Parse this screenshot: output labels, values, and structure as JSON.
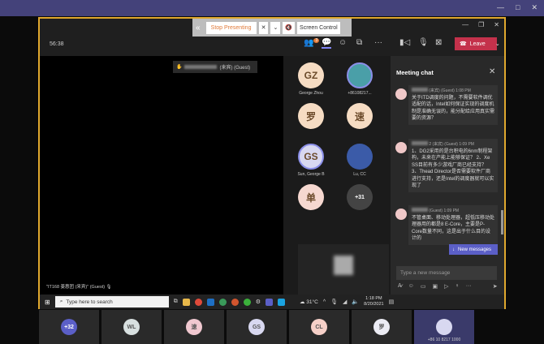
{
  "share_toolbar": {
    "stop_label": "Stop Presenting",
    "screen_control": "Screen Control"
  },
  "header": {
    "timer": "56:38",
    "participants_badge": "3",
    "leave_label": "Leave"
  },
  "video": {
    "raised_hand_label": "(来宾) (Guest)",
    "presenter_label": "\"IT168 姜惠团 (来宾)\" (Guest)"
  },
  "participants": [
    {
      "initials": "GZ",
      "name": "George Zhou",
      "color": "#f6dcc3"
    },
    {
      "initials": "",
      "name": "+86108217...",
      "color": "#4a9fa8"
    },
    {
      "initials": "罗",
      "name": "",
      "color": "#f6dcc3"
    },
    {
      "initials": "速",
      "name": "",
      "color": "#f6dcc3"
    },
    {
      "initials": "GS",
      "name": "Sun, George B",
      "color": "#d8d8f0"
    },
    {
      "initials": "",
      "name": "Lu, CC",
      "color": "#3b5ba8"
    },
    {
      "initials": "单",
      "name": "",
      "color": "#f6d8d0"
    },
    {
      "initials": "+31",
      "name": "",
      "color": "#444"
    }
  ],
  "chat": {
    "title": "Meeting chat",
    "messages": [
      {
        "author": "(来宾) (Guest)",
        "time": "1:08 PM",
        "text": "关于ITD调度的问题，不需要软件调优适配的话，Intel如何保证实现的调度机制是准确无误的，能分配给应用真实需要的资源？"
      },
      {
        "author": "2 (来宾) (Guest)",
        "time": "1:09 PM",
        "text": "1、DG2采用的是台积电的6nm制程架构，未来在产能上能够保证？ 2、Xe SS目前有多少游戏厂商已经支持？ 3、Thead Director是否需要软件厂商进行支持，还是Intel的调度器就可以实现了"
      },
      {
        "author": "(Guest)",
        "time": "1:09 PM",
        "text": "不管桌面、移动处理器，超低压移动处理器用的都是8 E-Core，主要是P-Core数量不同，这是出于什么目的设计的"
      }
    ],
    "new_messages": "New messages",
    "input_placeholder": "Type a new message"
  },
  "taskbar": {
    "search_placeholder": "Type here to search",
    "weather": "31°C",
    "time": "1:18 PM",
    "date": "8/20/2021"
  },
  "bottom_strip": [
    {
      "initials": "+32",
      "color": "#5b5fc7"
    },
    {
      "initials": "WL",
      "color": "#d8e0e0"
    },
    {
      "initials": "速",
      "color": "#f0c8d0"
    },
    {
      "initials": "GS",
      "color": "#d8d8f0"
    },
    {
      "initials": "CL",
      "color": "#f6d0c8"
    },
    {
      "initials": "罗",
      "color": "#ececf4"
    },
    {
      "initials": "",
      "color": "#d8d8f0",
      "name": "+86 10 8217 1000"
    }
  ]
}
